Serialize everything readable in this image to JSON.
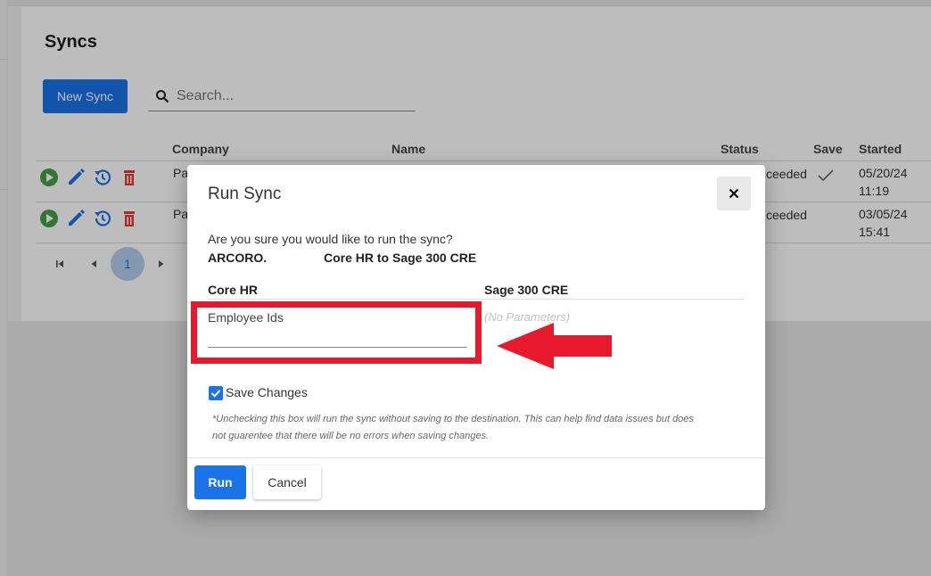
{
  "page": {
    "title": "Syncs",
    "new_sync_label": "New Sync",
    "search_placeholder": "Search..."
  },
  "table": {
    "columns": [
      "Company",
      "Name",
      "Status",
      "Save",
      "Started"
    ],
    "rows": [
      {
        "company": "Pa",
        "status": "ceeded",
        "save_checked": true,
        "started_date": "05/20/24",
        "started_time": "11:19"
      },
      {
        "company": "Pa",
        "status": "ceeded",
        "save_checked": false,
        "started_date": "03/05/24",
        "started_time": "15:41"
      }
    ],
    "row_actions": [
      "play-icon",
      "edit-icon",
      "history-icon",
      "delete-icon"
    ]
  },
  "pagination": {
    "current_page": "1",
    "icons": [
      "first-page-icon",
      "prev-page-icon",
      "next-page-icon"
    ]
  },
  "dialog": {
    "title": "Run Sync",
    "close_icon": "close-icon",
    "question": "Are you sure you would like to run the sync?",
    "company": "ARCORO.",
    "sync_name": "Core HR to Sage 300 CRE",
    "source_header": "Core HR",
    "destination_header": "Sage 300 CRE",
    "employee_ids_label": "Employee Ids",
    "employee_ids_value": "",
    "no_parameters": "(No Parameters)",
    "save_changes_label": "Save Changes",
    "save_changes_checked": true,
    "note_line1": "*Unchecking this box will run the sync without saving to the destination. This can help find data issues but does",
    "note_line2": "not guarentee that there will be no errors when saving changes.",
    "run_label": "Run",
    "cancel_label": "Cancel"
  },
  "colors": {
    "primary": "#1a73e8",
    "play": "#43a047",
    "delete": "#e53935",
    "annotation": "#e8192c"
  }
}
